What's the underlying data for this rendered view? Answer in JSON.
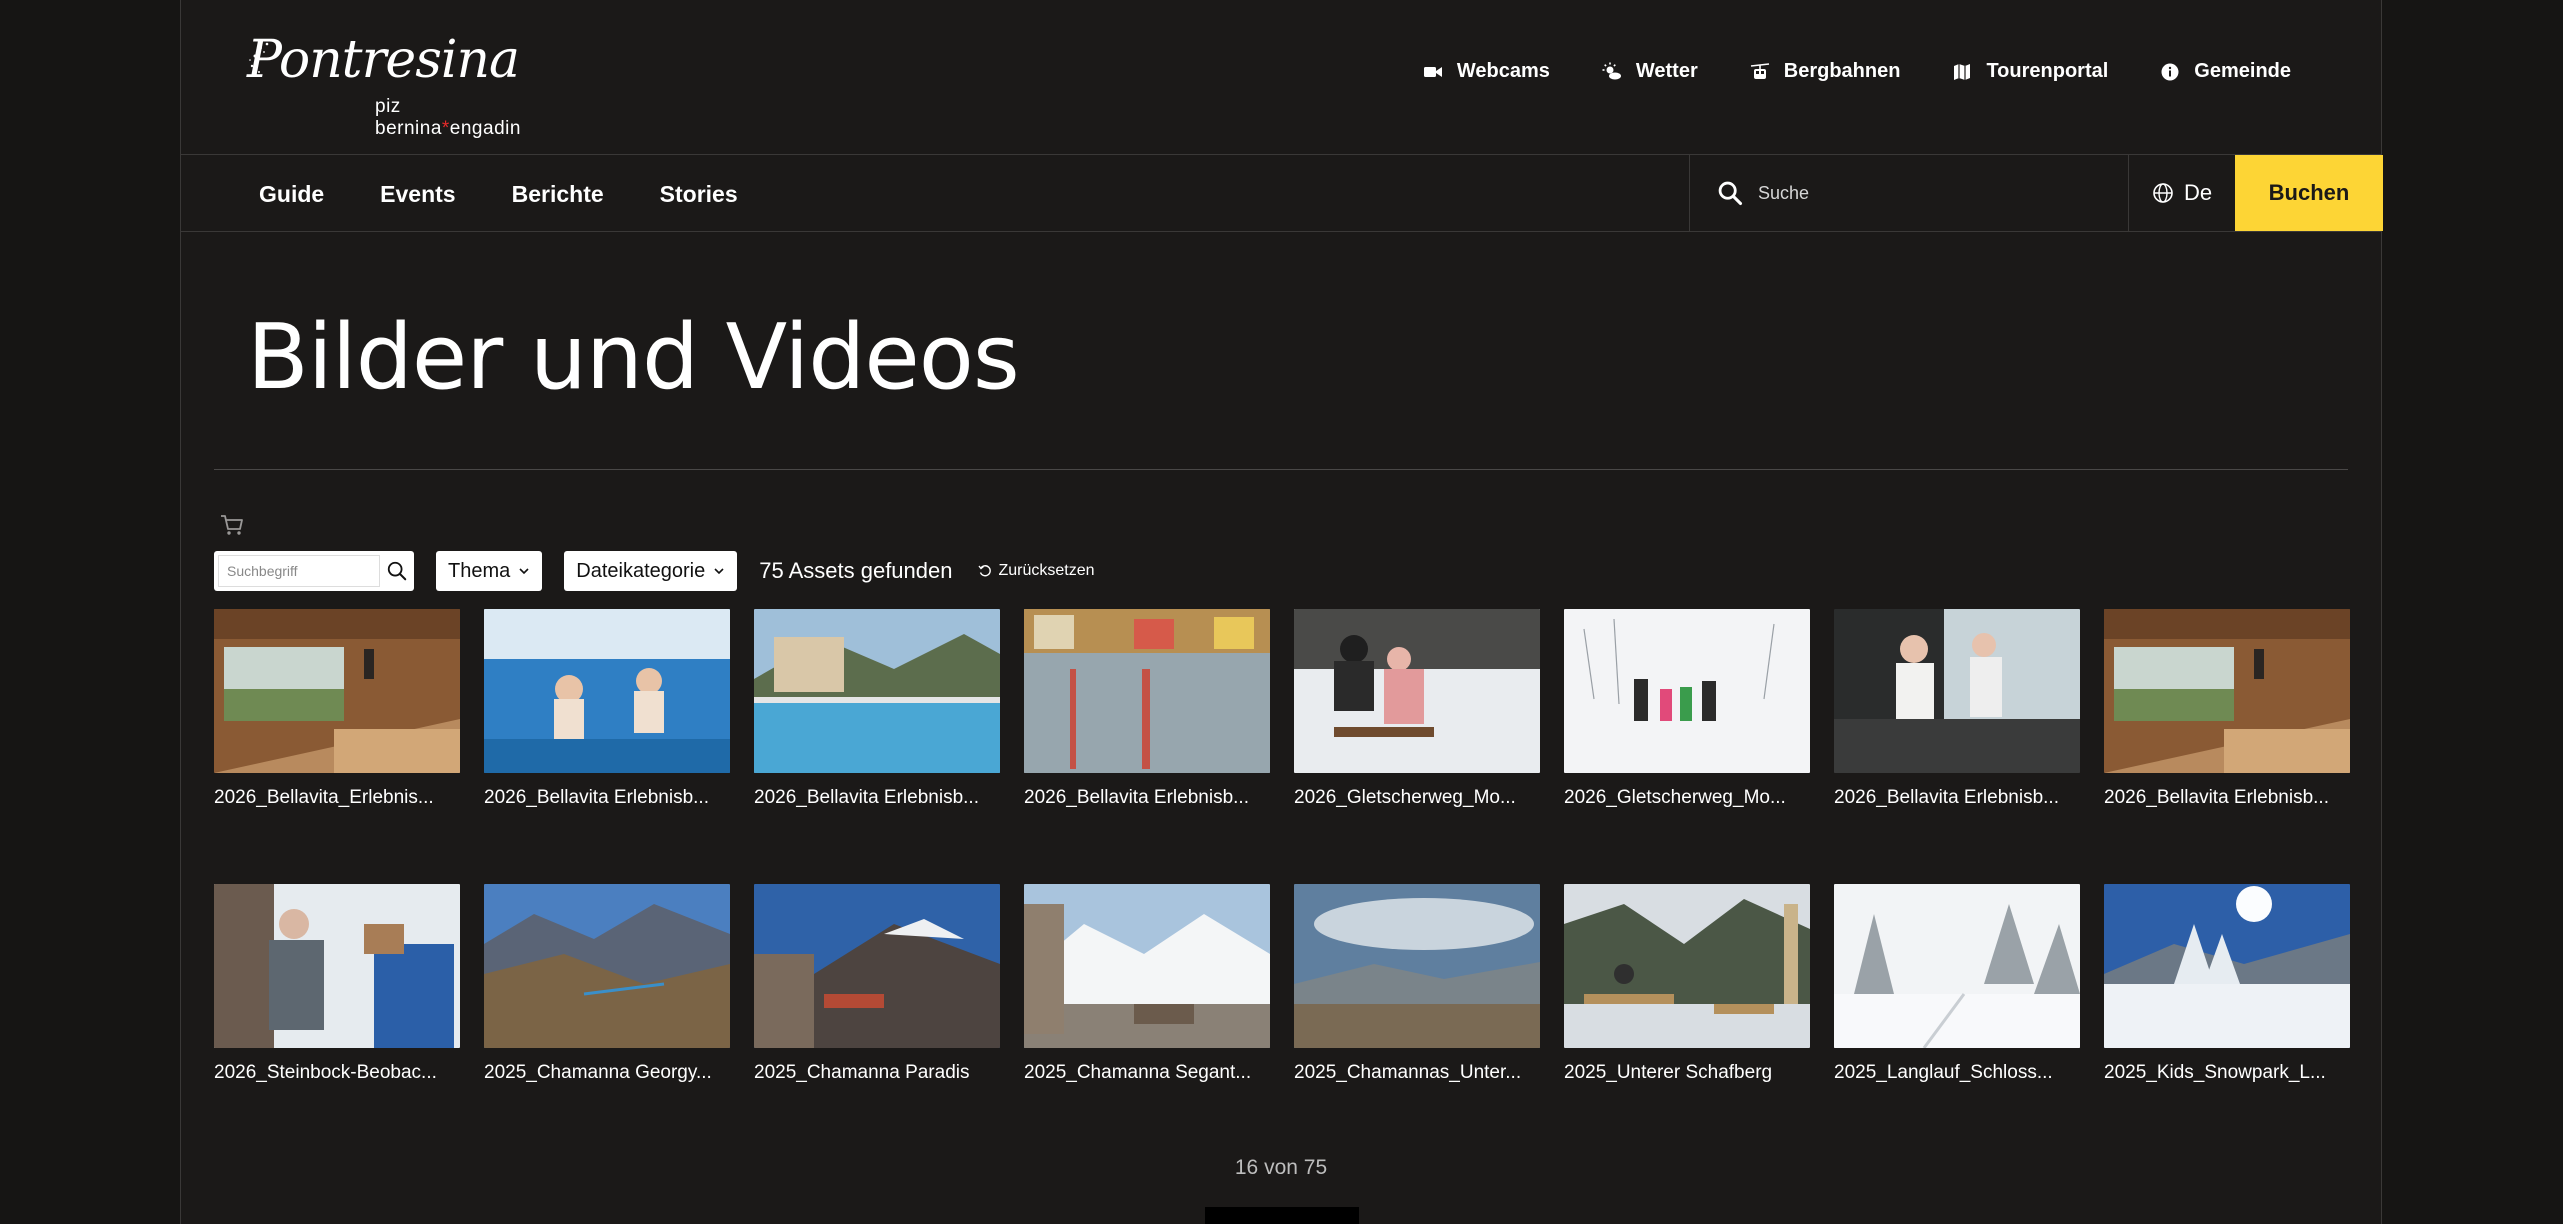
{
  "logo": {
    "word": "Pontresina",
    "sub_left": "piz bernina",
    "sub_star": "*",
    "sub_right": "engadin"
  },
  "util_nav": [
    {
      "label": "Webcams",
      "icon": "video-camera-icon"
    },
    {
      "label": "Wetter",
      "icon": "sun-cloud-icon"
    },
    {
      "label": "Bergbahnen",
      "icon": "cable-car-icon"
    },
    {
      "label": "Tourenportal",
      "icon": "map-icon"
    },
    {
      "label": "Gemeinde",
      "icon": "info-icon"
    }
  ],
  "main_nav": [
    "Guide",
    "Events",
    "Berichte",
    "Stories"
  ],
  "search": {
    "placeholder": "Suche"
  },
  "language": "De",
  "book_label": "Buchen",
  "page_title": "Bilder und Videos",
  "filters": {
    "search_placeholder": "Suchbegriff",
    "topic_label": "Thema",
    "category_label": "Dateikategorie",
    "result_count": "75 Assets gefunden",
    "reset_label": "Zurücksetzen"
  },
  "assets": [
    {
      "caption": "2026_Bellavita_Erlebnis...",
      "scene": "sauna-wood"
    },
    {
      "caption": "2026_Bellavita Erlebnisb...",
      "scene": "underwater"
    },
    {
      "caption": "2026_Bellavita Erlebnisb...",
      "scene": "outdoor-pool"
    },
    {
      "caption": "2026_Bellavita Erlebnisb...",
      "scene": "indoor-pool"
    },
    {
      "caption": "2026_Gletscherweg_Mo...",
      "scene": "sled-people"
    },
    {
      "caption": "2026_Gletscherweg_Mo...",
      "scene": "snow-walk"
    },
    {
      "caption": "2026_Bellavita Erlebnisb...",
      "scene": "spa-relax"
    },
    {
      "caption": "2026_Bellavita Erlebnisb...",
      "scene": "sauna-wood"
    },
    {
      "caption": "2026_Steinbock-Beobac...",
      "scene": "winter-guide"
    },
    {
      "caption": "2025_Chamanna Georgy...",
      "scene": "mountain-ridge"
    },
    {
      "caption": "2025_Chamanna Paradis",
      "scene": "mountain-terrace"
    },
    {
      "caption": "2025_Chamanna Segant...",
      "scene": "glacier-hut"
    },
    {
      "caption": "2025_Chamannas_Unter...",
      "scene": "mountain-cloudy"
    },
    {
      "caption": "2025_Unterer Schafberg",
      "scene": "valley-terrace"
    },
    {
      "caption": "2025_Langlauf_Schloss...",
      "scene": "snow-forest"
    },
    {
      "caption": "2025_Kids_Snowpark_L...",
      "scene": "snow-sunny"
    }
  ],
  "pager": "16 von 75",
  "colors": {
    "background": "#1b1918",
    "accent": "#fdd535"
  }
}
